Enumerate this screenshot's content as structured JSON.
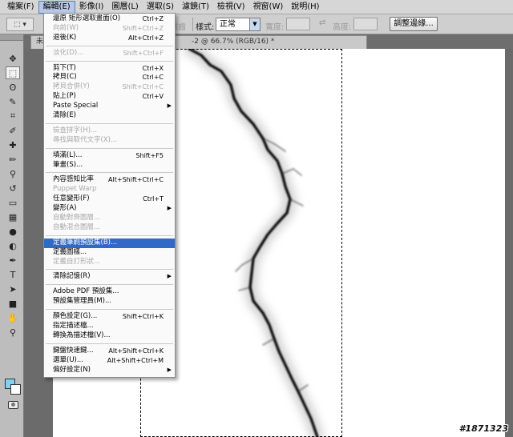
{
  "menubar": [
    {
      "label": "檔案(F)",
      "active": false
    },
    {
      "label": "編輯(E)",
      "active": true
    },
    {
      "label": "影像(I)",
      "active": false
    },
    {
      "label": "圖層(L)",
      "active": false
    },
    {
      "label": "選取(S)",
      "active": false
    },
    {
      "label": "濾鏡(T)",
      "active": false
    },
    {
      "label": "檢視(V)",
      "active": false
    },
    {
      "label": "視窗(W)",
      "active": false
    },
    {
      "label": "說明(H)",
      "active": false
    }
  ],
  "options": {
    "style_label": "樣式:",
    "style_value": "正常",
    "width_label": "寬度:",
    "height_label": "高度:",
    "refine_edge_button": "調整邊緣...",
    "dim_label": "消除鋸齒"
  },
  "document_tab": {
    "title_left": "未命",
    "title_right": "-2 @ 66.7% (RGB/16) *"
  },
  "edit_menu": [
    {
      "type": "item",
      "label": "還原 矩形選取畫面(O)",
      "shortcut": "Ctrl+Z"
    },
    {
      "type": "item",
      "label": "向前(W)",
      "shortcut": "Shift+Ctrl+Z",
      "disabled": true
    },
    {
      "type": "item",
      "label": "退後(K)",
      "shortcut": "Alt+Ctrl+Z"
    },
    {
      "type": "sep"
    },
    {
      "type": "item",
      "label": "淡化(D)...",
      "shortcut": "Shift+Ctrl+F",
      "disabled": true
    },
    {
      "type": "sep"
    },
    {
      "type": "item",
      "label": "剪下(T)",
      "shortcut": "Ctrl+X"
    },
    {
      "type": "item",
      "label": "拷貝(C)",
      "shortcut": "Ctrl+C"
    },
    {
      "type": "item",
      "label": "拷貝合併(Y)",
      "shortcut": "Shift+Ctrl+C",
      "disabled": true
    },
    {
      "type": "item",
      "label": "貼上(P)",
      "shortcut": "Ctrl+V"
    },
    {
      "type": "item",
      "label": "Paste Special",
      "submenu": true
    },
    {
      "type": "item",
      "label": "清除(E)"
    },
    {
      "type": "sep"
    },
    {
      "type": "item",
      "label": "檢查拼字(H)...",
      "disabled": true
    },
    {
      "type": "item",
      "label": "尋找與取代文字(X)...",
      "disabled": true
    },
    {
      "type": "sep"
    },
    {
      "type": "item",
      "label": "填滿(L)...",
      "shortcut": "Shift+F5"
    },
    {
      "type": "item",
      "label": "筆畫(S)..."
    },
    {
      "type": "sep"
    },
    {
      "type": "item",
      "label": "內容感知比率",
      "shortcut": "Alt+Shift+Ctrl+C"
    },
    {
      "type": "item",
      "label": "Puppet Warp",
      "disabled": true
    },
    {
      "type": "item",
      "label": "任意變形(F)",
      "shortcut": "Ctrl+T"
    },
    {
      "type": "item",
      "label": "變形(A)",
      "submenu": true
    },
    {
      "type": "item",
      "label": "自動對齊圖層...",
      "disabled": true
    },
    {
      "type": "item",
      "label": "自動混合圖層...",
      "disabled": true
    },
    {
      "type": "sep"
    },
    {
      "type": "item",
      "label": "定義筆刷預設集(B)...",
      "highlight": true
    },
    {
      "type": "item",
      "label": "定義圖樣..."
    },
    {
      "type": "item",
      "label": "定義自訂形狀...",
      "disabled": true
    },
    {
      "type": "sep"
    },
    {
      "type": "item",
      "label": "清除記憶(R)",
      "submenu": true
    },
    {
      "type": "sep"
    },
    {
      "type": "item",
      "label": "Adobe PDF 預設集..."
    },
    {
      "type": "item",
      "label": "預設集管理員(M)..."
    },
    {
      "type": "sep"
    },
    {
      "type": "item",
      "label": "顏色設定(G)...",
      "shortcut": "Shift+Ctrl+K"
    },
    {
      "type": "item",
      "label": "指定描述檔..."
    },
    {
      "type": "item",
      "label": "轉換為描述檔(V)..."
    },
    {
      "type": "sep"
    },
    {
      "type": "item",
      "label": "鍵盤快速鍵...",
      "shortcut": "Alt+Shift+Ctrl+K"
    },
    {
      "type": "item",
      "label": "選單(U)...",
      "shortcut": "Alt+Shift+Ctrl+M"
    },
    {
      "type": "item",
      "label": "偏好設定(N)",
      "submenu": true
    }
  ],
  "tools": [
    "move-tool",
    "marquee-tool",
    "lasso-tool",
    "quick-select-tool",
    "crop-tool",
    "eyedropper-tool",
    "spot-heal-tool",
    "brush-tool",
    "stamp-tool",
    "history-brush-tool",
    "eraser-tool",
    "gradient-tool",
    "blur-tool",
    "dodge-tool",
    "pen-tool",
    "type-tool",
    "path-select-tool",
    "shape-tool",
    "hand-tool",
    "zoom-tool"
  ],
  "colors": {
    "foreground": "#7fd3f0",
    "background": "#ffffff",
    "highlight": "#3169c6"
  },
  "watermark": "#1871323"
}
